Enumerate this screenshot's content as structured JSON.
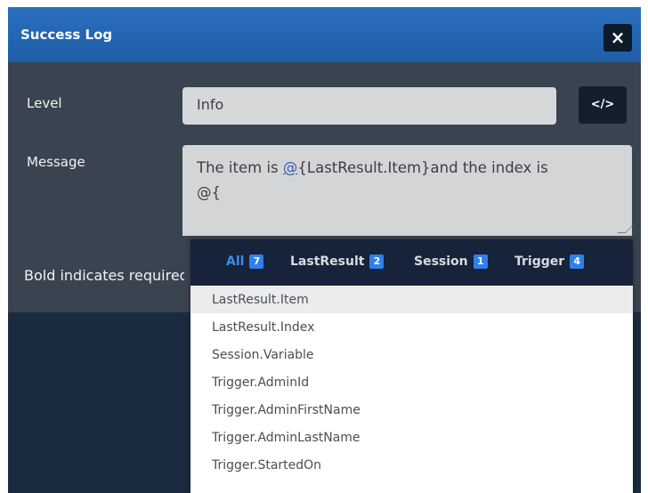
{
  "dialog": {
    "title": "Success Log",
    "close_icon_glyph": "×"
  },
  "form": {
    "level_label": "Level",
    "level_value": "Info",
    "code_button_glyph": "</>",
    "message_label": "Message",
    "message_prefix": "The item is ",
    "message_token_at": "@",
    "message_token_rest": "{LastResult.Item}",
    "message_suffix": "and the index is",
    "message_line2": "@{",
    "help_text": "Bold indicates required"
  },
  "autocomplete": {
    "tabs": [
      {
        "label": "All",
        "count": "7"
      },
      {
        "label": "LastResult",
        "count": "2"
      },
      {
        "label": "Session",
        "count": "1"
      },
      {
        "label": "Trigger",
        "count": "4"
      }
    ],
    "items": [
      "LastResult.Item",
      "LastResult.Index",
      "Session.Variable",
      "Trigger.AdminId",
      "Trigger.AdminFirstName",
      "Trigger.AdminLastName",
      "Trigger.StartedOn"
    ],
    "highlighted_index": 0
  },
  "colors": {
    "titlebar": "#2169b8",
    "panel": "#3a4350",
    "accent": "#2f80ed"
  }
}
